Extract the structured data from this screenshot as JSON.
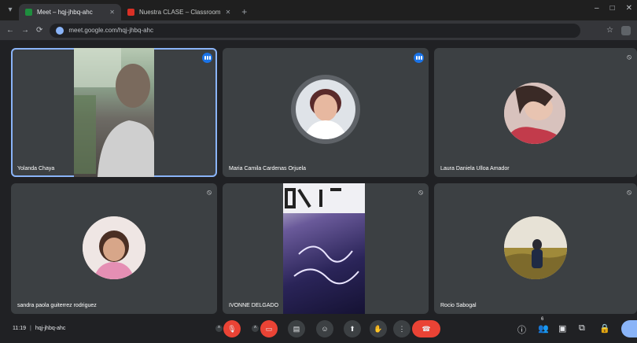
{
  "browser": {
    "tabs": [
      {
        "title": "Meet – hqj-jhbq-ahc",
        "active": true,
        "favicon": "meet-icon"
      },
      {
        "title": "Nuestra CLASE – Classroom",
        "active": false,
        "favicon": "classroom-icon"
      }
    ],
    "url": "meet.google.com/hqj-jhbq-ahc"
  },
  "participants": [
    {
      "name": "Yolanda Chaya",
      "media": "video",
      "speaking": true
    },
    {
      "name": "Maria Camila Cardenas Orjuela",
      "media": "avatar",
      "speaking": true
    },
    {
      "name": "Laura Daniela Ulloa Amador",
      "media": "avatar",
      "muted": true
    },
    {
      "name": "sandra paola guiterrez rodriguez",
      "media": "avatar",
      "muted": true
    },
    {
      "name": "IVONNE DELGADO",
      "media": "video",
      "muted": true
    },
    {
      "name": "Rocio Sabogal",
      "media": "avatar",
      "muted": true
    }
  ],
  "meeting": {
    "time": "11:19",
    "code": "hqj-jhbq-ahc",
    "participant_count": "6"
  },
  "colors": {
    "accent": "#8ab4f8",
    "speaking_badge": "#1a73e8",
    "danger": "#ea4335",
    "tile_bg": "#3c4043",
    "page_bg": "#202124"
  }
}
